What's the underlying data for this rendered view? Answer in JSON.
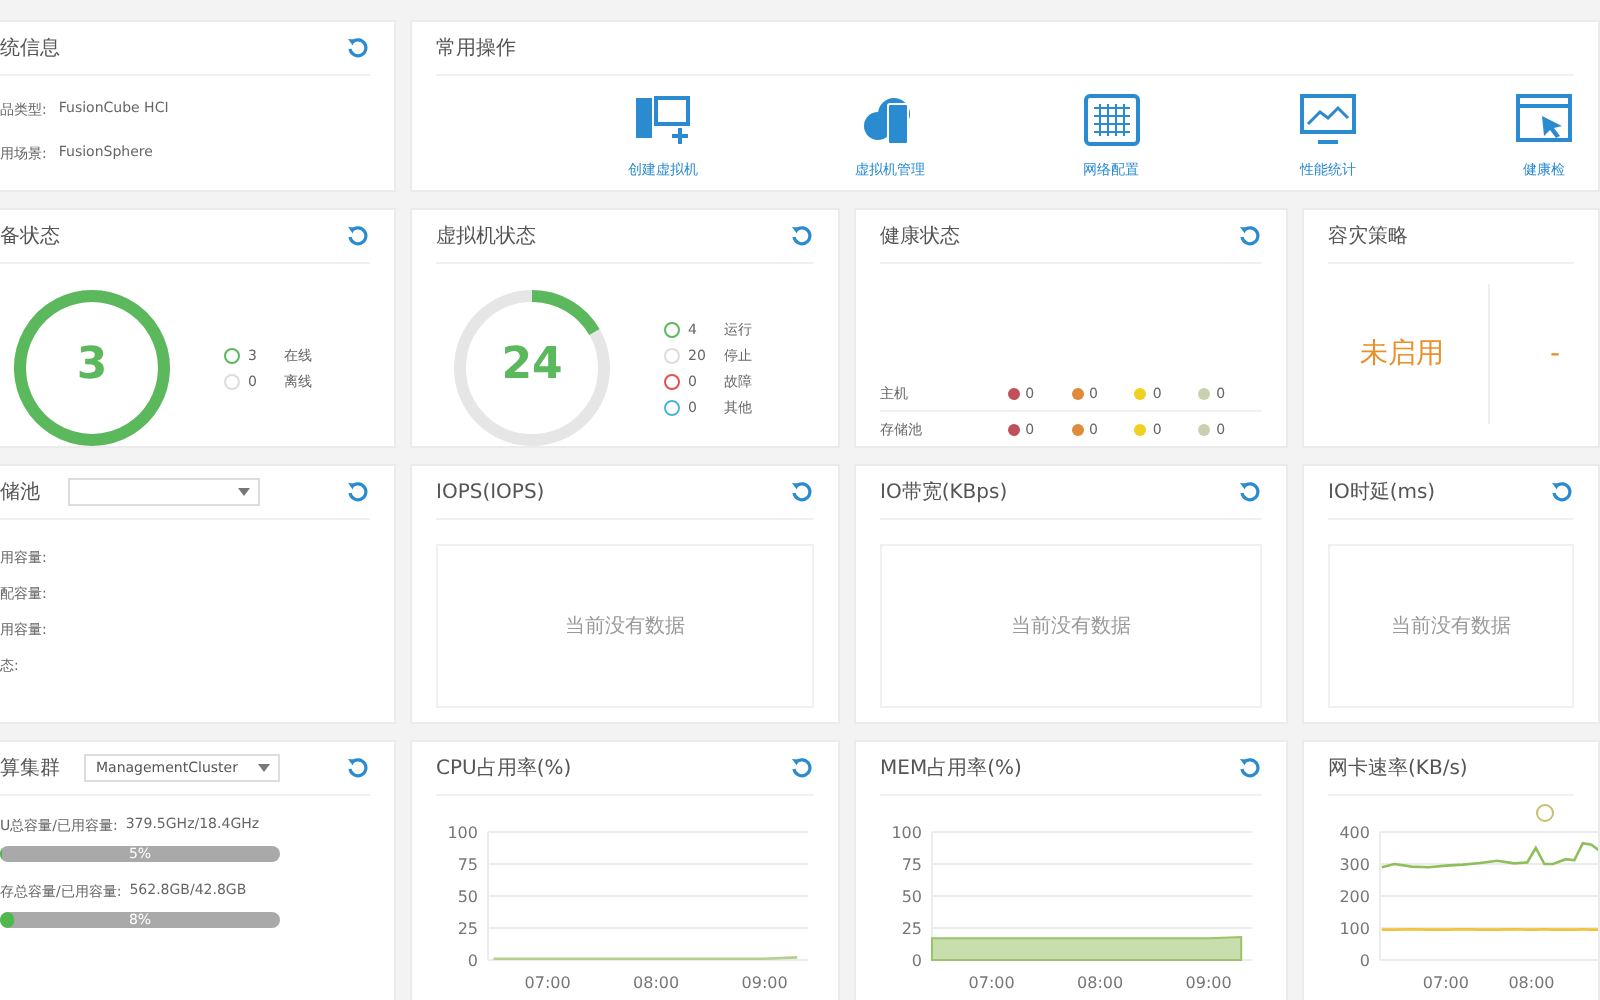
{
  "system_info": {
    "title": "统信息",
    "fields": [
      {
        "label": "品类型:",
        "value": "FusionCube HCI"
      },
      {
        "label": "用场景:",
        "value": "FusionSphere"
      }
    ]
  },
  "quick_actions": {
    "title": "常用操作",
    "items": [
      {
        "label": "创建虚拟机"
      },
      {
        "label": "虚拟机管理"
      },
      {
        "label": "网络配置"
      },
      {
        "label": "性能统计"
      },
      {
        "label": "健康检"
      }
    ]
  },
  "device_status": {
    "title": "备状态",
    "total": "3",
    "legend": [
      {
        "count": "3",
        "label": "在线",
        "color": "#5cb85c"
      },
      {
        "count": "0",
        "label": "离线",
        "color": "#dddddd"
      }
    ]
  },
  "vm_status": {
    "title": "虚拟机状态",
    "total": "24",
    "legend": [
      {
        "count": "4",
        "label": "运行",
        "color": "#5cb85c"
      },
      {
        "count": "20",
        "label": "停止",
        "color": "#dddddd"
      },
      {
        "count": "0",
        "label": "故障",
        "color": "#e05050"
      },
      {
        "count": "0",
        "label": "其他",
        "color": "#4ab8d8"
      }
    ]
  },
  "health_status": {
    "title": "健康状态",
    "rows": [
      {
        "name": "主机",
        "cells": [
          {
            "value": "0",
            "color": "#c0505a"
          },
          {
            "value": "0",
            "color": "#e08a3c"
          },
          {
            "value": "0",
            "color": "#f0d020"
          },
          {
            "value": "0",
            "color": "#c8d0b0"
          }
        ]
      },
      {
        "name": "存储池",
        "cells": [
          {
            "value": "0",
            "color": "#c0505a"
          },
          {
            "value": "0",
            "color": "#e08a3c"
          },
          {
            "value": "0",
            "color": "#f0d020"
          },
          {
            "value": "0",
            "color": "#c8d0b0"
          }
        ]
      }
    ]
  },
  "dr_policy": {
    "title": "容灾策略",
    "status": "未启用",
    "status_2": "-"
  },
  "storage_pool": {
    "title": "储池",
    "fields": [
      "用容量:",
      "配容量:",
      "用容量:",
      "态:"
    ]
  },
  "iops": {
    "title": "IOPS(IOPS)",
    "empty": "当前没有数据"
  },
  "io_bandwidth": {
    "title": "IO带宽(KBps)",
    "empty": "当前没有数据"
  },
  "io_latency": {
    "title": "IO时延(ms)",
    "empty": "当前没有数据"
  },
  "compute_cluster": {
    "title": "算集群",
    "selected": "ManagementCluster",
    "meters": [
      {
        "label": "U总容量/已用容量:",
        "value": "379.5GHz/18.4GHz",
        "reading": "5%",
        "level": 0.01
      },
      {
        "label": "存总容量/已用容量:",
        "value": "562.8GB/42.8GB",
        "reading": "8%",
        "level": 0.05
      }
    ]
  },
  "cpu_usage": {
    "title": "CPU占用率(%)",
    "chart_data": {
      "type": "line",
      "grid": true,
      "x": [
        6.5,
        7,
        7.5,
        8,
        8.5,
        9,
        9.3
      ],
      "series": [
        {
          "color": "#b5cf8c",
          "values": [
            1,
            1,
            1,
            1,
            1,
            1,
            2
          ]
        }
      ],
      "xlim": [
        6.45,
        9.4
      ],
      "ylim": [
        0,
        100
      ],
      "yticks": [
        0,
        25,
        50,
        75,
        100
      ],
      "xticks": [
        {
          "value": 7,
          "label": "07:00"
        },
        {
          "value": 8,
          "label": "08:00"
        },
        {
          "value": 9,
          "label": "09:00"
        }
      ]
    }
  },
  "mem_usage": {
    "title": "MEM占用率(%)",
    "chart_data": {
      "type": "area",
      "grid": true,
      "x": [
        6.45,
        7,
        7.5,
        8,
        8.5,
        9,
        9.3
      ],
      "series": [
        {
          "color": "#9cc26a",
          "values": [
            17,
            17,
            17,
            17,
            17,
            17,
            18
          ]
        }
      ],
      "xlim": [
        6.45,
        9.4
      ],
      "ylim": [
        0,
        100
      ],
      "yticks": [
        0,
        25,
        50,
        75,
        100
      ],
      "xticks": [
        {
          "value": 7,
          "label": "07:00"
        },
        {
          "value": 8,
          "label": "08:00"
        },
        {
          "value": 9,
          "label": "09:00"
        }
      ]
    }
  },
  "nic_rate": {
    "title": "网卡速率(KB/s)",
    "chart_data": {
      "type": "line",
      "grid": true,
      "x": [
        6.25,
        6.4,
        6.6,
        6.8,
        7,
        7.2,
        7.4,
        7.6,
        7.8,
        7.95,
        8.05,
        8.15,
        8.25,
        8.4,
        8.5,
        8.6,
        8.7,
        8.8
      ],
      "series": [
        {
          "color": "#8dbf5a",
          "values": [
            290,
            300,
            292,
            290,
            295,
            298,
            303,
            310,
            302,
            305,
            350,
            300,
            300,
            315,
            312,
            365,
            360,
            340
          ]
        },
        {
          "color": "#f0c23c",
          "values": [
            95,
            95,
            96,
            95,
            95,
            96,
            95,
            95,
            96,
            95,
            95,
            96,
            95,
            95,
            95,
            96,
            95,
            95
          ]
        }
      ],
      "xlim": [
        6.23,
        8.8
      ],
      "ylim": [
        0,
        400
      ],
      "yticks": [
        0,
        100,
        200,
        300,
        400
      ],
      "xticks": [
        {
          "value": 7,
          "label": "07:00"
        },
        {
          "value": 8,
          "label": "08:00"
        }
      ]
    }
  }
}
